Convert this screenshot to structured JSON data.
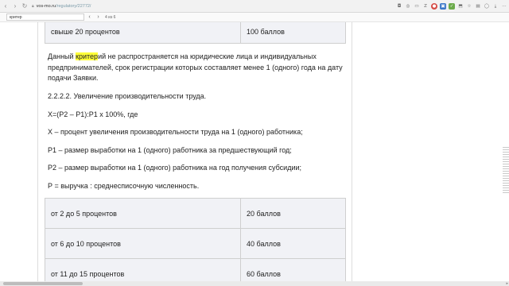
{
  "browser": {
    "url_host": "vos-mo.ru",
    "url_path": "/regulatory/22772/",
    "ext_z": "Z"
  },
  "findbar": {
    "query": "критер",
    "match_count": "4 из 6"
  },
  "document": {
    "top_table": [
      {
        "condition": "свыше 20 процентов",
        "score": "100 баллов"
      }
    ],
    "paragraph_1": {
      "before": "Данный ",
      "highlight": "критер",
      "after": "ий не распространяется на юридические лица и индивидуальных предпринимателей, срок регистрации которых составляет менее 1 (одного) года на дату подачи Заявки."
    },
    "section_heading": "2.2.2.2. Увеличение производительности труда.",
    "formula": "Х=(Р2 – Р1):Р1 х 100%, где",
    "definitions": [
      "Х – процент увеличения производительности труда на 1 (одного) работника;",
      "Р1 – размер выработки на 1 (одного) работника за предшествующий год;",
      "Р2 – размер выработки на 1 (одного) работника на год получения субсидии;",
      "Р = выручка : среднесписочную численность."
    ],
    "score_table": [
      {
        "range": "от 2 до 5 процентов",
        "score": "20 баллов"
      },
      {
        "range": "от 6 до 10 процентов",
        "score": "40 баллов"
      },
      {
        "range": "от 11 до 15 процентов",
        "score": "60 баллов"
      }
    ]
  }
}
